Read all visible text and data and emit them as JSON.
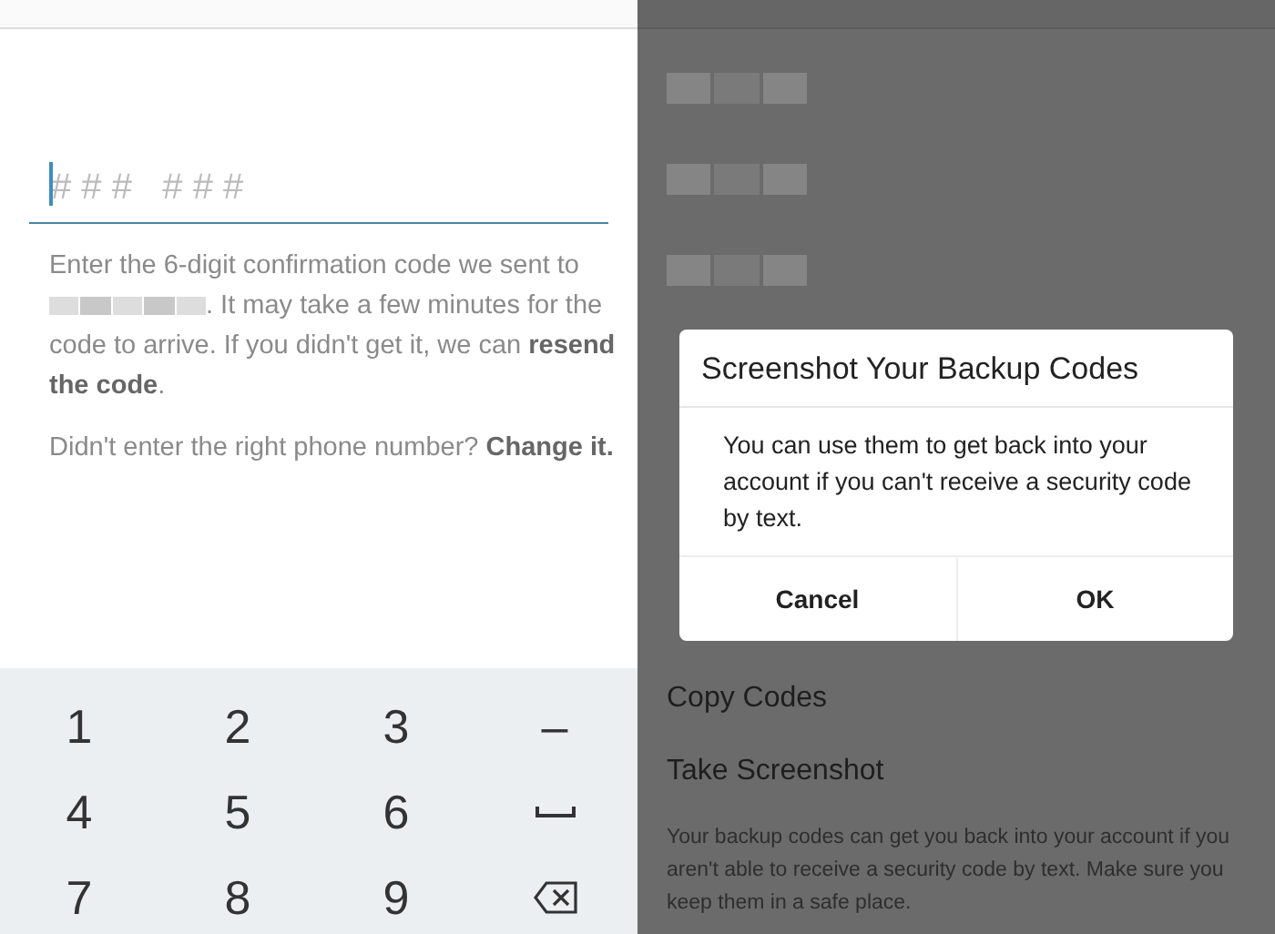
{
  "code_screen": {
    "code_field": {
      "placeholder": "# # #   # # #"
    },
    "help_text": {
      "before": "Enter the 6-digit confirmation code we sent to",
      "after": ". It may take a few minutes for the code to arrive. If you didn't get it, we can **resend the code**."
    },
    "phone_prompt": "Didn't enter the right phone number? **Change it.**",
    "keypad": [
      {
        "kind": "char",
        "label": "1"
      },
      {
        "kind": "char",
        "label": "2"
      },
      {
        "kind": "char",
        "label": "3"
      },
      {
        "kind": "char",
        "label": "–"
      },
      {
        "kind": "char",
        "label": "4"
      },
      {
        "kind": "char",
        "label": "5"
      },
      {
        "kind": "char",
        "label": "6"
      },
      {
        "kind": "space"
      },
      {
        "kind": "char",
        "label": "7"
      },
      {
        "kind": "char",
        "label": "8"
      },
      {
        "kind": "char",
        "label": "9"
      },
      {
        "kind": "backspace"
      }
    ]
  },
  "backup_screen": {
    "actions": [
      "Copy Codes",
      "Take Screenshot"
    ],
    "footer": "Your backup codes can get you back into your account if you aren't able to receive a security code by text. Make sure you keep them in a safe place.",
    "dialog": {
      "title": "Screenshot Your Backup Codes",
      "body": "You can use them to get back into your account if you can't receive a security code by text.",
      "buttons": [
        "Cancel",
        "OK"
      ]
    }
  }
}
